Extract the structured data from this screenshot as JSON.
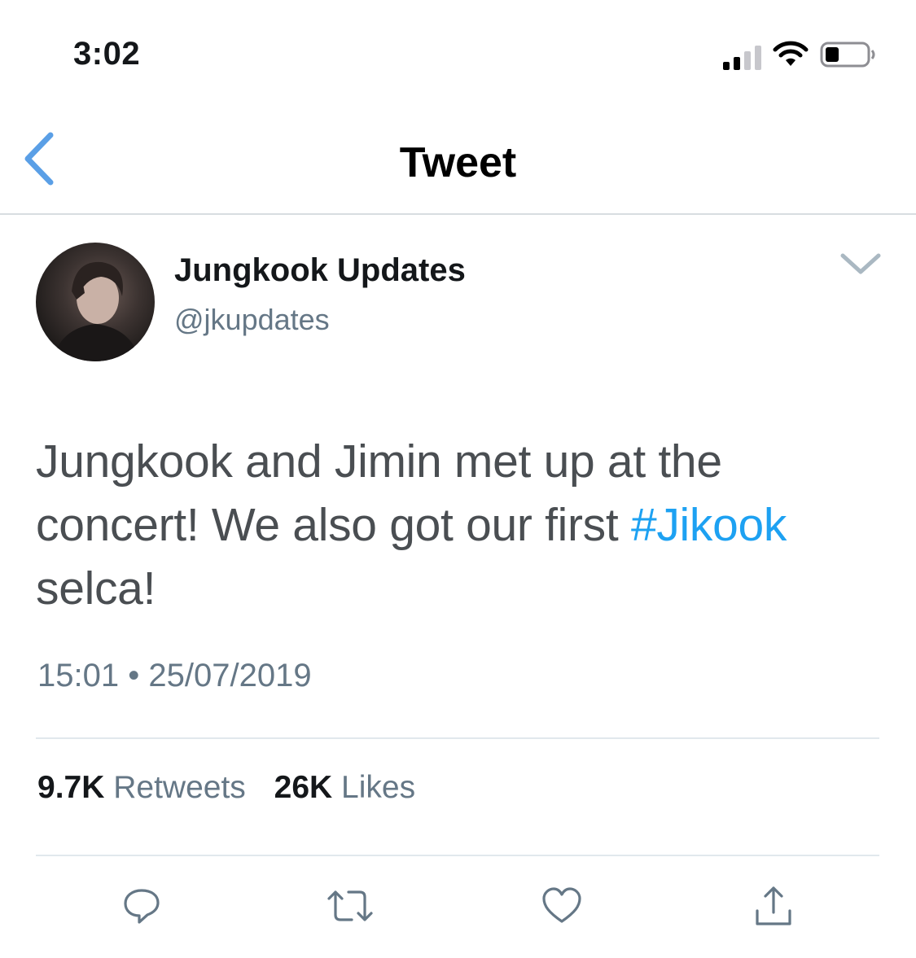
{
  "status_bar": {
    "time": "3:02",
    "icons": [
      "cellular-signal-icon",
      "wifi-icon",
      "battery-icon"
    ]
  },
  "nav": {
    "title": "Tweet",
    "back_icon": "chevron-left-icon"
  },
  "tweet": {
    "author": {
      "display_name": "Jungkook Updates",
      "handle": "@jkupdates"
    },
    "text_before": "Jungkook and Jimin met up at the concert! We also got our first ",
    "hashtag": "#Jikook",
    "text_after": " selca!",
    "time": "15:01",
    "separator": "•",
    "date": "25/07/2019",
    "retweets_count": "9.7K",
    "retweets_label": "Retweets",
    "likes_count": "26K",
    "likes_label": "Likes"
  },
  "actions": [
    "reply-icon",
    "retweet-icon",
    "like-icon",
    "share-icon"
  ],
  "colors": {
    "accent": "#1da1f2",
    "back_arrow": "#5a9fe6",
    "secondary_text": "#657786",
    "divider": "#e1e8ed"
  }
}
